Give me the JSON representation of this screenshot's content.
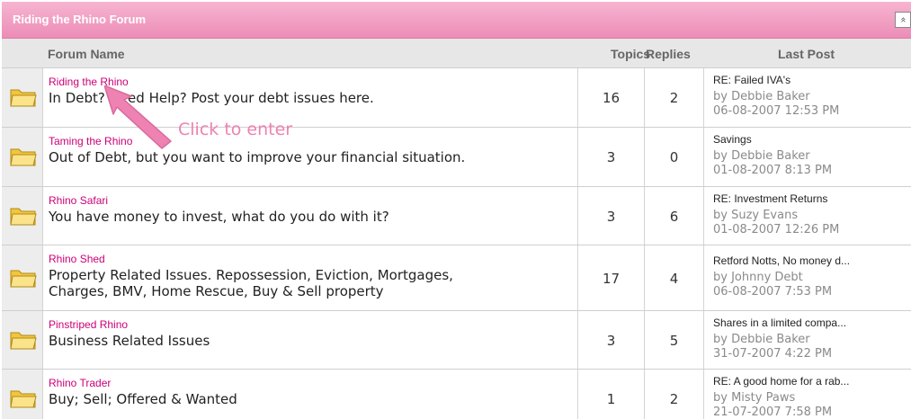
{
  "forum_category": {
    "title": "Riding the Rhino Forum",
    "collapse_icon": "double-chevron-up-icon",
    "collapse_glyph": "»"
  },
  "headers": {
    "forum_name": "Forum Name",
    "topics": "Topics",
    "replies": "Replies",
    "last_post": "Last Post"
  },
  "forums": [
    {
      "name": "Riding the Rhino",
      "description": "In Debt? Need Help? Post your debt issues here.",
      "topics": "16",
      "replies": "2",
      "last_post": {
        "title": "RE: Failed IVA's",
        "by": "by Debbie Baker",
        "date": "06-08-2007 12:53 PM"
      }
    },
    {
      "name": "Taming the Rhino",
      "description": "Out of Debt, but you want to improve your financial situation.",
      "topics": "3",
      "replies": "0",
      "last_post": {
        "title": "Savings",
        "by": "by Debbie Baker",
        "date": "01-08-2007 8:13 PM"
      }
    },
    {
      "name": "Rhino Safari",
      "description": "You have money to invest, what do you do with it?",
      "topics": "3",
      "replies": "6",
      "last_post": {
        "title": "RE: Investment Returns",
        "by": "by Suzy Evans",
        "date": "01-08-2007 12:26 PM"
      }
    },
    {
      "name": "Rhino Shed",
      "description": "Property Related Issues. Repossession, Eviction, Mortgages,\nCharges, BMV, Home Rescue, Buy & Sell property",
      "topics": "17",
      "replies": "4",
      "last_post": {
        "title": "Retford Notts, No money d...",
        "by": "by Johnny Debt",
        "date": "06-08-2007 7:53 PM"
      }
    },
    {
      "name": "Pinstriped Rhino",
      "description": "Business Related Issues",
      "topics": "3",
      "replies": "5",
      "last_post": {
        "title": "Shares in a limited compa...",
        "by": "by Debbie Baker",
        "date": "31-07-2007 4:22 PM"
      }
    },
    {
      "name": "Rhino Trader",
      "description": "Buy; Sell; Offered & Wanted",
      "topics": "1",
      "replies": "2",
      "last_post": {
        "title": "RE: A good home for a rab...",
        "by": "by Misty Paws",
        "date": "21-07-2007 7:58 PM"
      }
    }
  ],
  "annotation": {
    "text": "Click to enter",
    "icon": "pink-arrow-icon",
    "color": "#ee82b2"
  },
  "colors": {
    "title_bar": "#ec8db7",
    "forum_link": "#cc0077",
    "header_bg": "#e7e7e7"
  }
}
